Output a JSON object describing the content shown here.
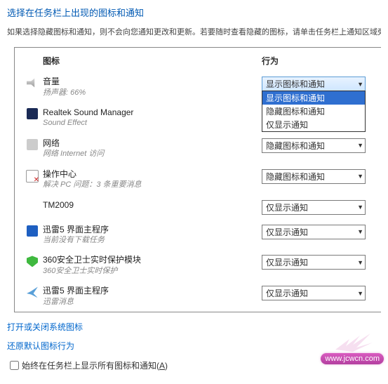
{
  "header": {
    "title": "选择在任务栏上出现的图标和通知",
    "subtitle": "如果选择隐藏图标和通知，则不会向您通知更改和更新。若要随时查看隐藏的图标，请单击任务栏上通知区域旁的"
  },
  "columns": {
    "icon_col": "图标",
    "action_col": "行为"
  },
  "dropdown_options": {
    "opt1": "显示图标和通知",
    "opt2": "隐藏图标和通知",
    "opt3": "仅显示通知"
  },
  "items": [
    {
      "primary": "音量",
      "secondary": "扬声器: 66%",
      "value": "显示图标和通知",
      "icon": "speaker",
      "open": true
    },
    {
      "primary": "Realtek Sound Manager",
      "secondary": "Sound Effect",
      "value": "",
      "icon": "realtek"
    },
    {
      "primary": "网络",
      "secondary": "网络 Internet 访问",
      "value": "隐藏图标和通知",
      "icon": "network"
    },
    {
      "primary": "操作中心",
      "secondary": "解决 PC 问题：3 条重要消息",
      "value": "隐藏图标和通知",
      "icon": "flag"
    },
    {
      "primary": "TM2009",
      "secondary": "",
      "value": "仅显示通知",
      "icon": ""
    },
    {
      "primary": "迅雷5 界面主程序",
      "secondary": "当前没有下载任务",
      "value": "仅显示通知",
      "icon": "xl"
    },
    {
      "primary": "360安全卫士实时保护模块",
      "secondary": "360安全卫士实时保护",
      "value": "仅显示通知",
      "icon": "shield"
    },
    {
      "primary": "迅雷5 界面主程序",
      "secondary": "迅雷消息",
      "value": "仅显示通知",
      "icon": "bird"
    }
  ],
  "links": {
    "system_icons": "打开或关闭系统图标",
    "restore_defaults": "还原默认图标行为"
  },
  "checkbox": {
    "label_prefix": "始终在任务栏上显示所有图标和通知(",
    "label_accel": "A",
    "label_suffix": ")"
  },
  "watermark": "www.jcwcn.com"
}
